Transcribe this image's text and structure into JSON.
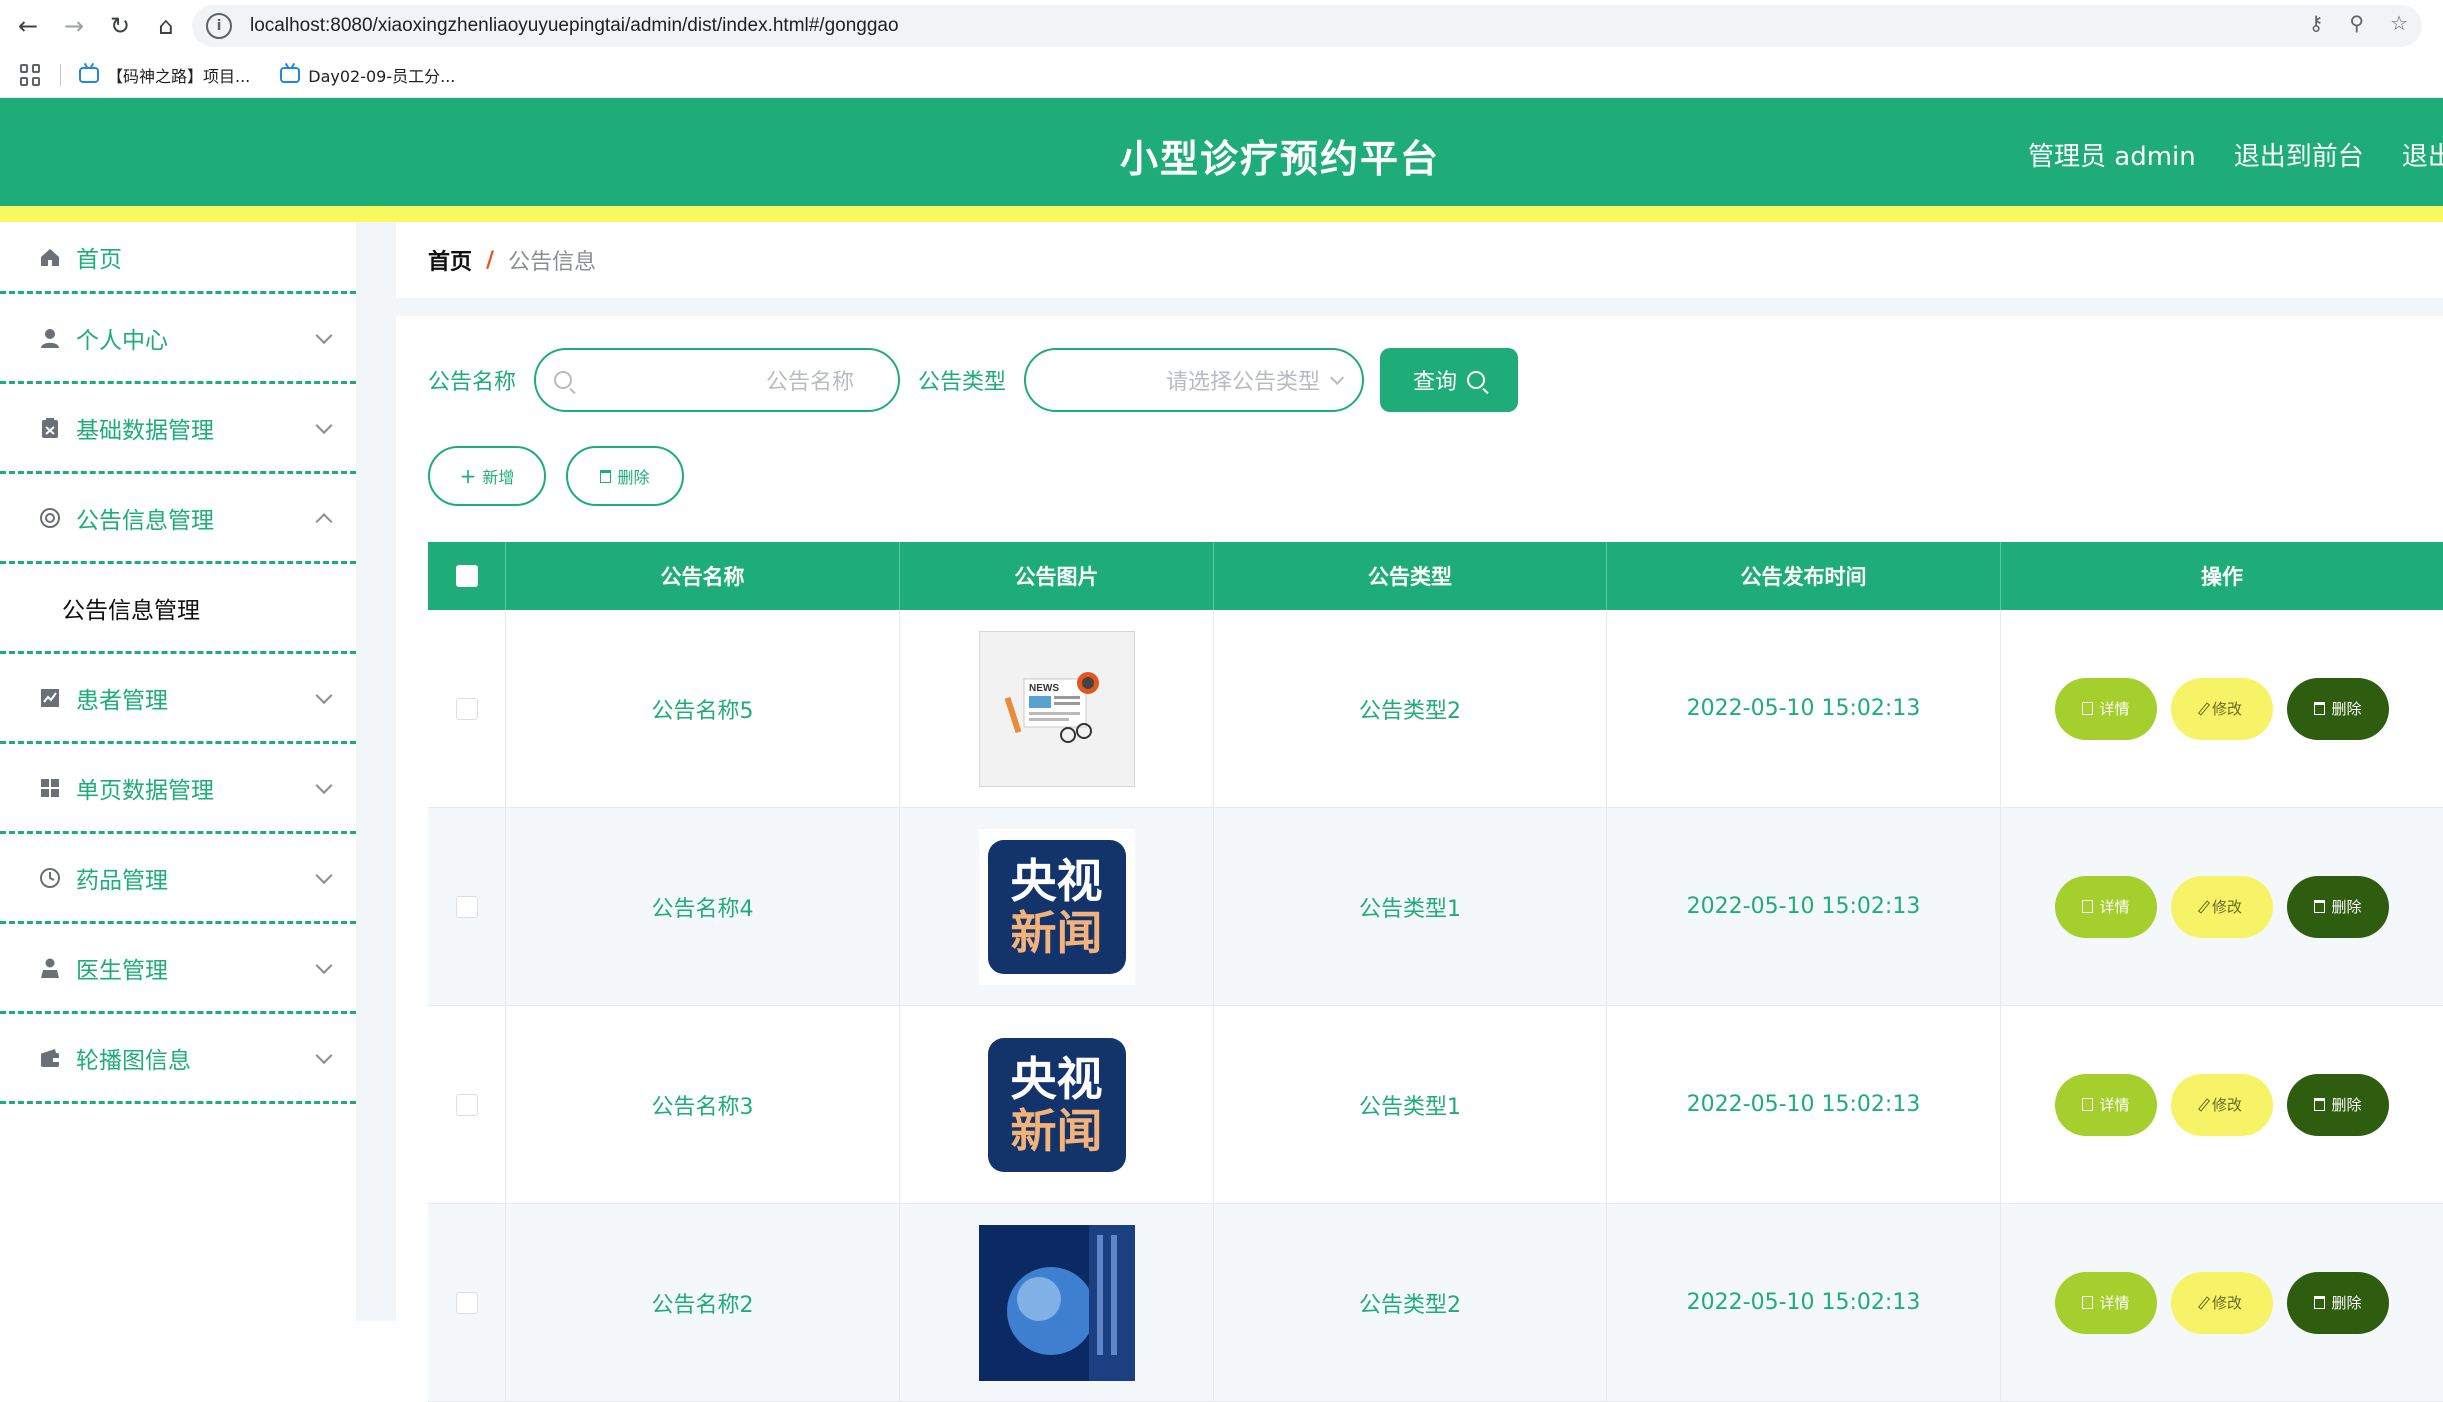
{
  "browser": {
    "url": "localhost:8080/xiaoxingzhenliaoyuyuepingtai/admin/dist/index.html#/gonggao",
    "bookmarks": [
      "【码神之路】项目...",
      "Day02-09-员工分..."
    ]
  },
  "header": {
    "title": "小型诊疗预约平台",
    "links": [
      "管理员 admin",
      "退出到前台",
      "退出登录"
    ]
  },
  "sidebar": {
    "items": [
      {
        "label": "首页",
        "icon": "home-icon"
      },
      {
        "label": "个人中心",
        "icon": "user-icon"
      },
      {
        "label": "基础数据管理",
        "icon": "clipboard-icon"
      },
      {
        "label": "公告信息管理",
        "icon": "lifebuoy-icon",
        "expanded": true
      },
      {
        "label": "患者管理",
        "icon": "chart-icon"
      },
      {
        "label": "单页数据管理",
        "icon": "grid-icon"
      },
      {
        "label": "药品管理",
        "icon": "clock-icon"
      },
      {
        "label": "医生管理",
        "icon": "person-icon"
      },
      {
        "label": "轮播图信息",
        "icon": "wallet-icon"
      }
    ],
    "submenu": [
      "公告信息管理"
    ]
  },
  "breadcrumb": {
    "home": "首页",
    "sep": "/",
    "current": "公告信息"
  },
  "search": {
    "name_label": "公告名称",
    "name_placeholder": "公告名称",
    "type_label": "公告类型",
    "type_placeholder": "请选择公告类型",
    "query_label": "查询"
  },
  "actions": {
    "add": "新增",
    "delete": "删除"
  },
  "table": {
    "columns": [
      "公告名称",
      "公告图片",
      "公告类型",
      "公告发布时间",
      "操作"
    ],
    "rows": [
      {
        "name": "公告名称5",
        "image": "news-image",
        "type": "公告类型2",
        "time": "2022-05-10 15:02:13"
      },
      {
        "name": "公告名称4",
        "image": "cctv-image",
        "type": "公告类型1",
        "time": "2022-05-10 15:02:13"
      },
      {
        "name": "公告名称3",
        "image": "cctv-image",
        "type": "公告类型1",
        "time": "2022-05-10 15:02:13"
      },
      {
        "name": "公告名称2",
        "image": "globe-image",
        "type": "公告类型2",
        "time": "2022-05-10 15:02:13"
      }
    ],
    "ops": {
      "detail": "详情",
      "edit": "修改",
      "delete": "删除"
    }
  },
  "cctv_badge": {
    "line1": "央视",
    "line2": "新闻"
  },
  "news_badge": "NEWS",
  "colors": {
    "primary": "#1ead78",
    "accent": "#f7f95c",
    "detail": "#a4cf2c",
    "edit": "#f6f466",
    "delete": "#2f5d10"
  }
}
